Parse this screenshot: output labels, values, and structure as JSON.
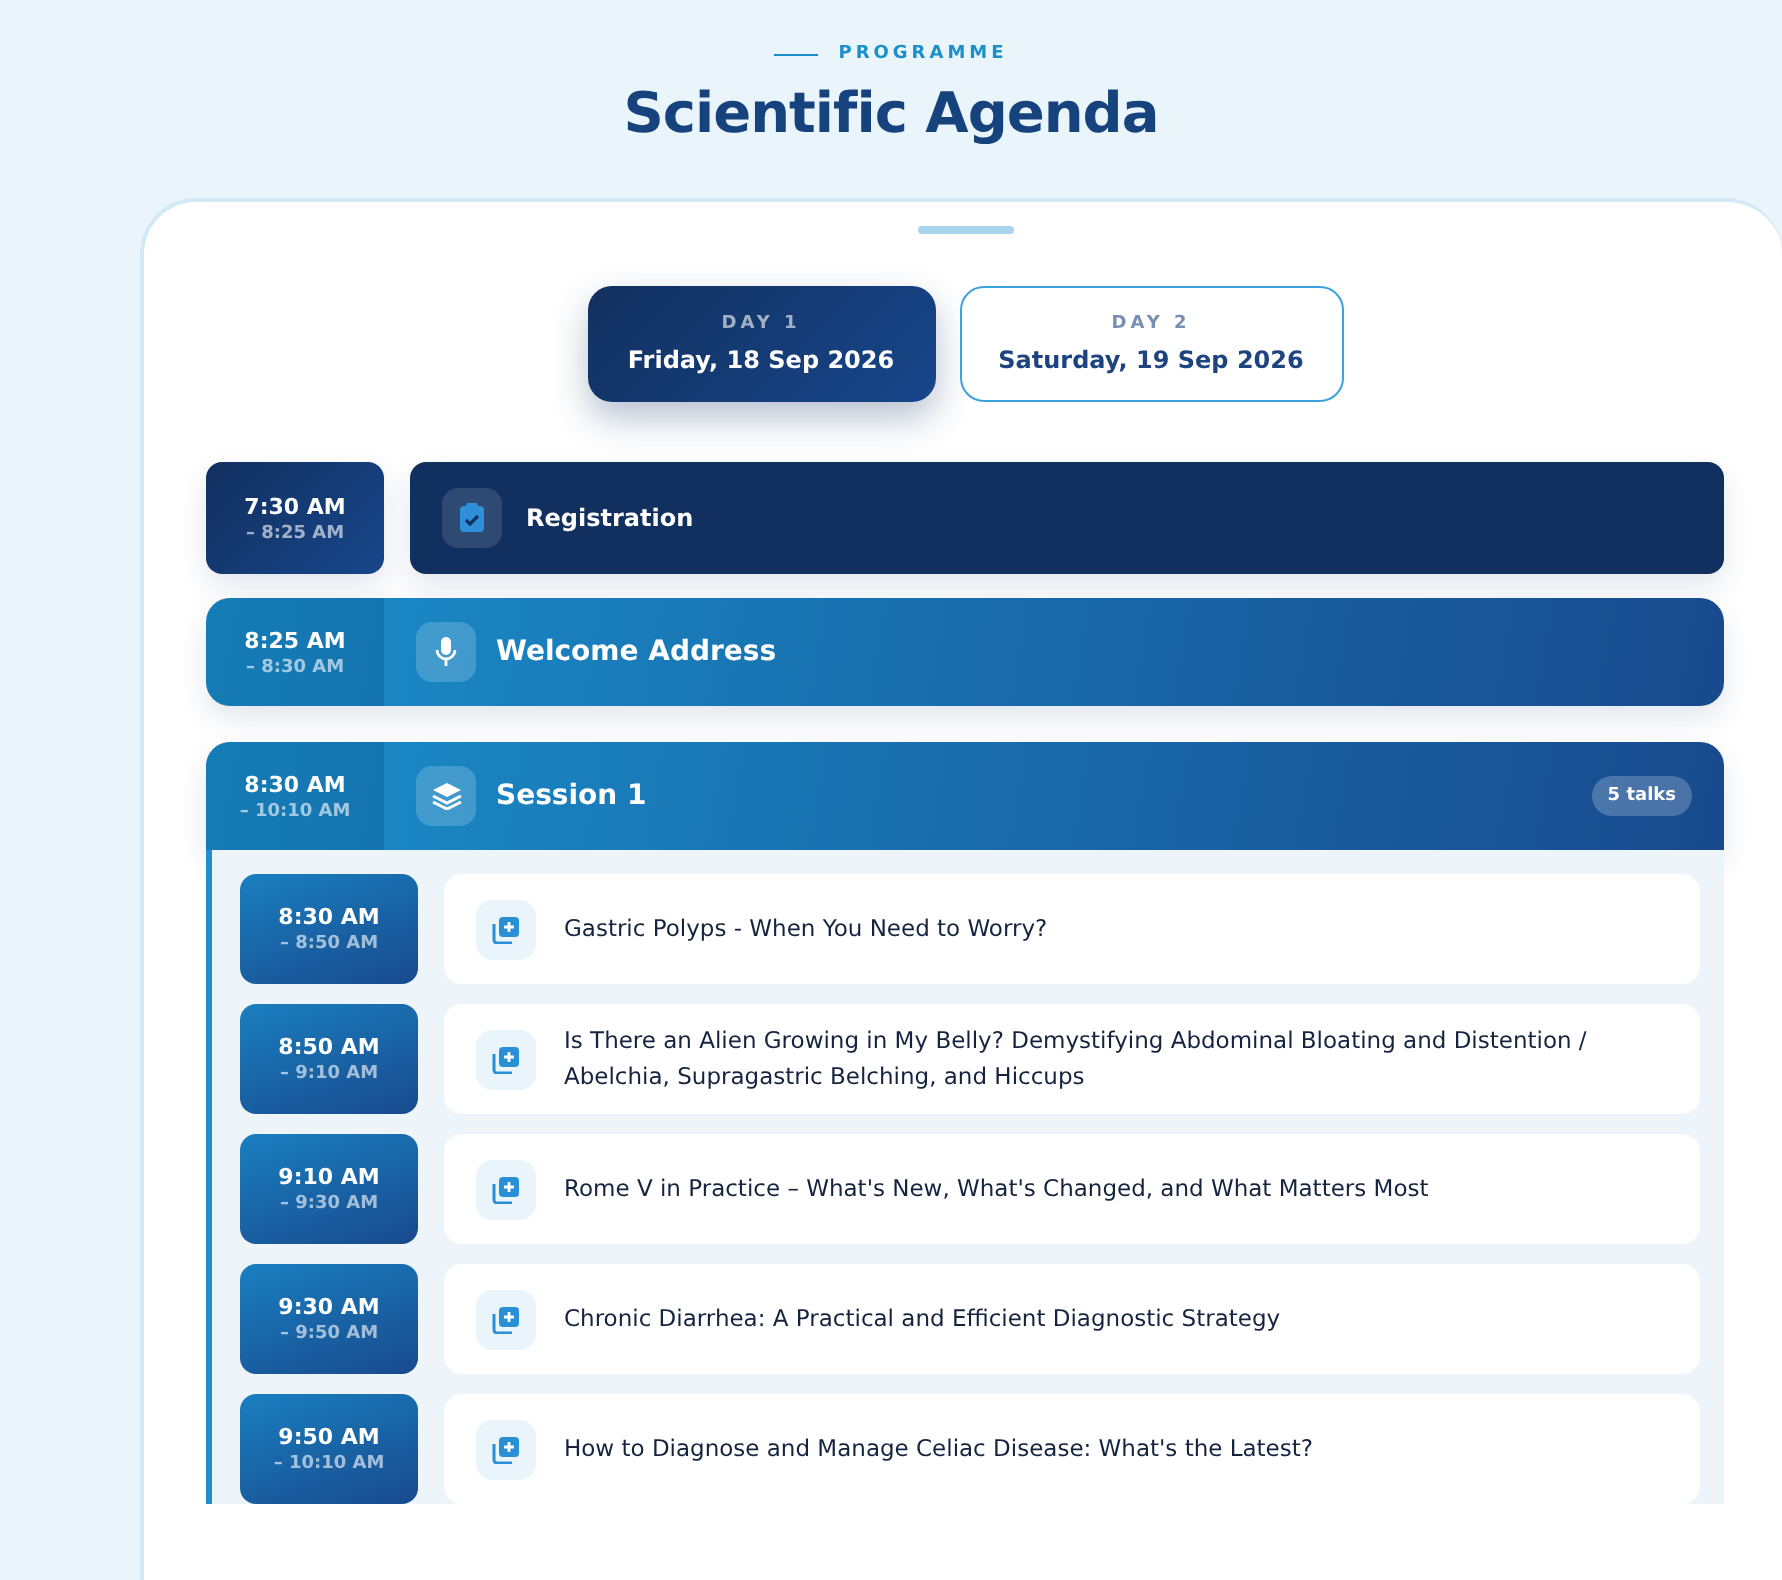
{
  "header": {
    "eyebrow": "PROGRAMME",
    "title": "Scientific Agenda"
  },
  "days": [
    {
      "label": "DAY 1",
      "date": "Friday, 18 Sep 2026",
      "selected": true
    },
    {
      "label": "DAY 2",
      "date": "Saturday, 19 Sep 2026",
      "selected": false
    }
  ],
  "agenda": [
    {
      "kind": "admin",
      "start": "7:30 AM",
      "end": "– 8:25 AM",
      "title": "Registration"
    },
    {
      "kind": "plenary",
      "start": "8:25 AM",
      "end": "– 8:30 AM",
      "title": "Welcome Address"
    },
    {
      "kind": "session",
      "start": "8:30 AM",
      "end": "– 10:10 AM",
      "title": "Session 1",
      "badge": "5 talks",
      "talks": [
        {
          "start": "8:30 AM",
          "end": "– 8:50 AM",
          "title": "Gastric Polyps - When You Need to Worry?"
        },
        {
          "start": "8:50 AM",
          "end": "– 9:10 AM",
          "title": "Is There an Alien Growing in My Belly? Demystifying Abdominal Bloating and Distention / Abelchia, Supragastric Belching, and Hiccups"
        },
        {
          "start": "9:10 AM",
          "end": "– 9:30 AM",
          "title": "Rome V in Practice – What's New, What's Changed, and What Matters Most"
        },
        {
          "start": "9:30 AM",
          "end": "– 9:50 AM",
          "title": "Chronic Diarrhea: A Practical and Efficient Diagnostic Strategy"
        },
        {
          "start": "9:50 AM",
          "end": "– 10:10 AM",
          "title": "How to Diagnose and Manage Celiac Disease: What's the Latest?"
        }
      ]
    }
  ]
}
